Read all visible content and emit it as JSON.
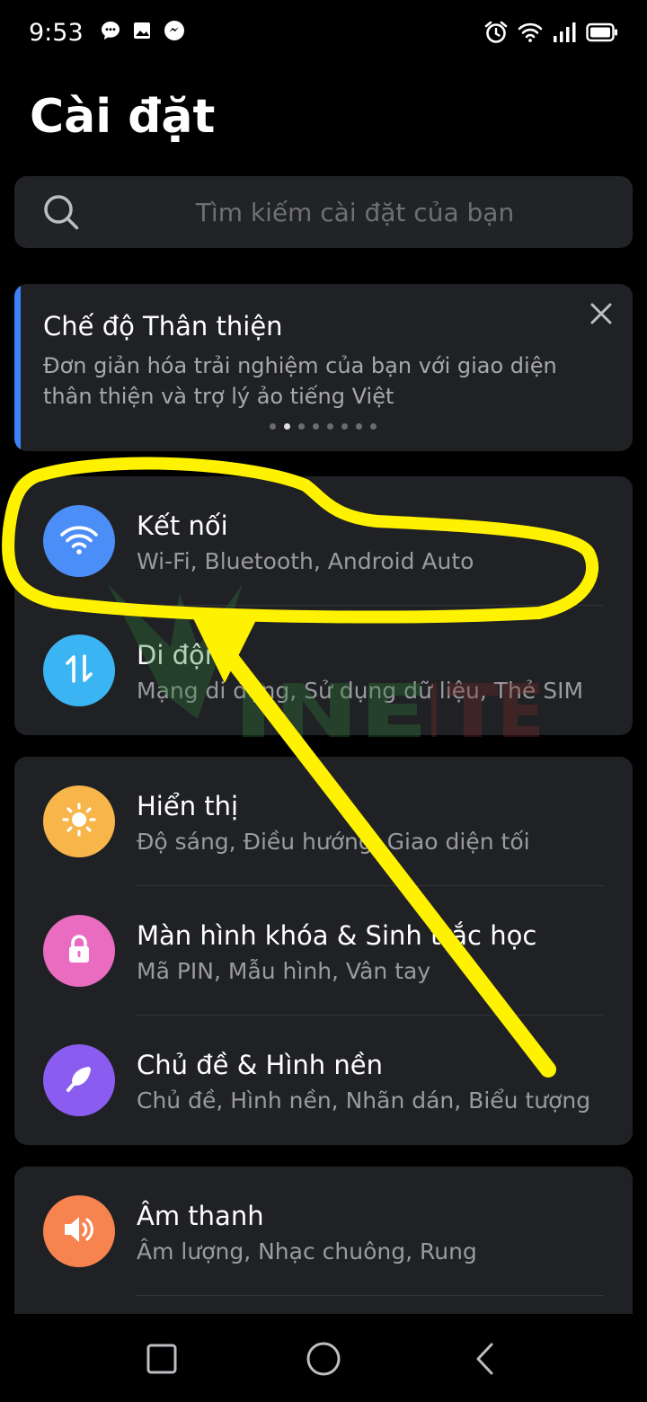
{
  "status_bar": {
    "time": "9:53",
    "left_icons": [
      "chat-bubble-icon",
      "image-icon",
      "messenger-icon"
    ],
    "right_icons": [
      "alarm-icon",
      "wifi-icon",
      "signal-icon",
      "battery-icon"
    ]
  },
  "page": {
    "title": "Cài đặt"
  },
  "search": {
    "placeholder": "Tìm kiếm cài đặt của bạn"
  },
  "banner": {
    "title": "Chế độ Thân thiện",
    "description": "Đơn giản hóa trải nghiệm của bạn với giao diện thân thiện và trợ lý ảo tiếng Việt",
    "dot_count": 8,
    "active_dot": 1,
    "accent_color": "#3c82f6"
  },
  "groups": [
    {
      "items": [
        {
          "title": "Kết nối",
          "subtitle": "Wi-Fi, Bluetooth, Android Auto",
          "icon": "wifi-icon",
          "color": "#4c8ef7"
        },
        {
          "title": "Di động",
          "subtitle": "Mạng di động, Sử dụng dữ liệu, Thẻ SIM",
          "icon": "data-transfer-icon",
          "color": "#3ab4f2"
        }
      ]
    },
    {
      "items": [
        {
          "title": "Hiển thị",
          "subtitle": "Độ sáng, Điều hướng, Giao diện tối",
          "icon": "brightness-icon",
          "color": "#f7b54a"
        },
        {
          "title": "Màn hình khóa & Sinh trắc học",
          "subtitle": "Mã PIN, Mẫu hình, Vân tay",
          "icon": "lock-icon",
          "color": "#ea6cc0"
        },
        {
          "title": "Chủ đề & Hình nền",
          "subtitle": "Chủ đề, Hình nền, Nhãn dán, Biểu tượng",
          "icon": "brush-icon",
          "color": "#8b5cf0"
        }
      ]
    },
    {
      "items": [
        {
          "title": "Âm thanh",
          "subtitle": "Âm lượng, Nhạc chuông, Rung",
          "icon": "speaker-icon",
          "color": "#f7834f"
        }
      ]
    }
  ],
  "nav_bar": {
    "buttons": [
      "recent-apps-icon",
      "home-icon",
      "back-icon"
    ]
  },
  "overlay": {
    "annotation_color": "#fff200",
    "watermark_color": "#2f7a3a"
  }
}
